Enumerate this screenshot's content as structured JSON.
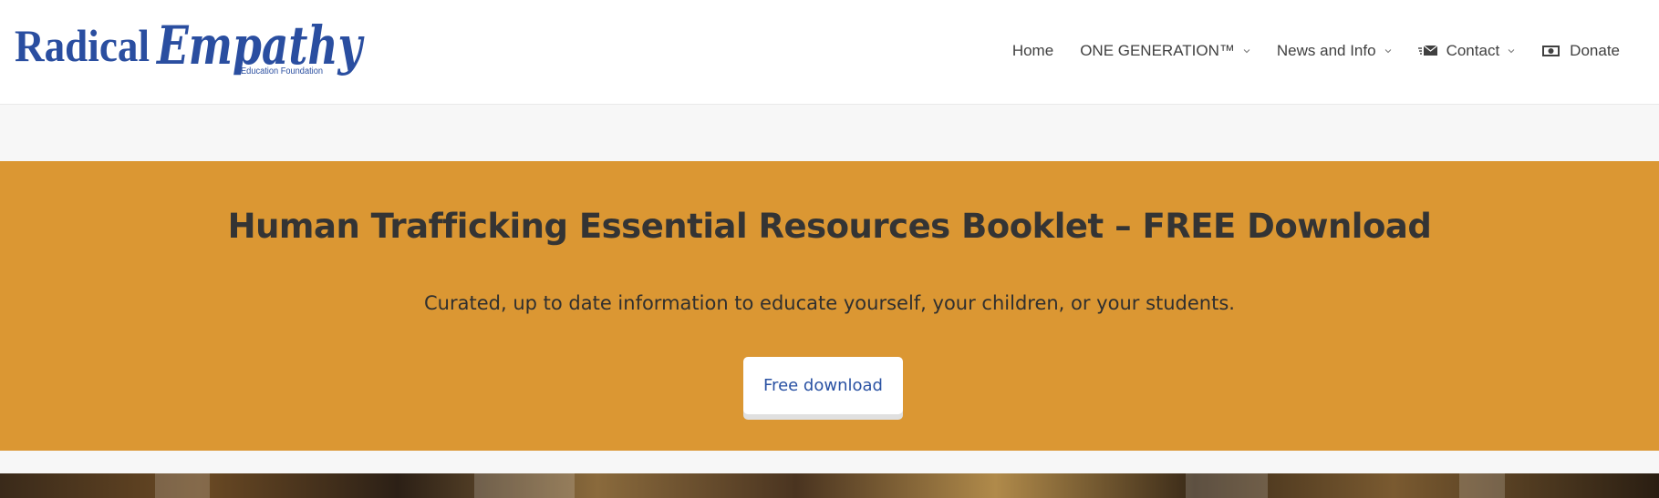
{
  "brand": {
    "name_left": "Radical",
    "name_right": "Empathy",
    "tagline": "Education Foundation",
    "color": "#2a4ea0"
  },
  "nav": {
    "items": [
      {
        "label": "Home",
        "has_dropdown": false,
        "icon": ""
      },
      {
        "label": "ONE GENERATION™",
        "has_dropdown": true,
        "icon": ""
      },
      {
        "label": "News and Info",
        "has_dropdown": true,
        "icon": ""
      },
      {
        "label": "Contact",
        "has_dropdown": true,
        "icon": "envelope-icon"
      },
      {
        "label": "Donate",
        "has_dropdown": false,
        "icon": "money-icon"
      }
    ]
  },
  "hero": {
    "title": "Human Trafficking Essential Resources Booklet – FREE Download",
    "subtitle": "Curated, up to date information to educate yourself, your children, or your students.",
    "button_label": "Free download",
    "background_color": "#db9733",
    "button_text_color": "#2a52a3"
  }
}
